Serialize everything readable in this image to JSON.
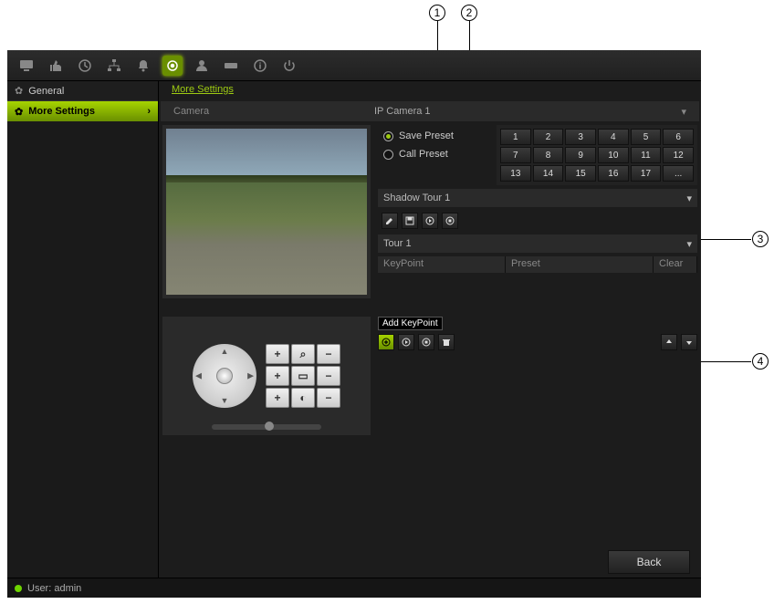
{
  "sidebar": {
    "items": [
      {
        "label": "General"
      },
      {
        "label": "More Settings"
      }
    ]
  },
  "tab_title": "More Settings",
  "camera": {
    "label": "Camera",
    "value": "IP Camera 1"
  },
  "preset": {
    "save_label": "Save Preset",
    "call_label": "Call Preset",
    "numbers": [
      "1",
      "2",
      "3",
      "4",
      "5",
      "6",
      "7",
      "8",
      "9",
      "10",
      "11",
      "12",
      "13",
      "14",
      "15",
      "16",
      "17",
      "..."
    ]
  },
  "shadow_tour": {
    "label": "Shadow Tour 1"
  },
  "tour": {
    "label": "Tour 1",
    "columns": {
      "keypoint": "KeyPoint",
      "preset": "Preset",
      "clear": "Clear"
    }
  },
  "tooltip": {
    "add_keypoint": "Add KeyPoint"
  },
  "buttons": {
    "back": "Back"
  },
  "status": {
    "user_label": "User: admin"
  },
  "callouts": {
    "c1": "1",
    "c2": "2",
    "c3": "3",
    "c4": "4"
  }
}
